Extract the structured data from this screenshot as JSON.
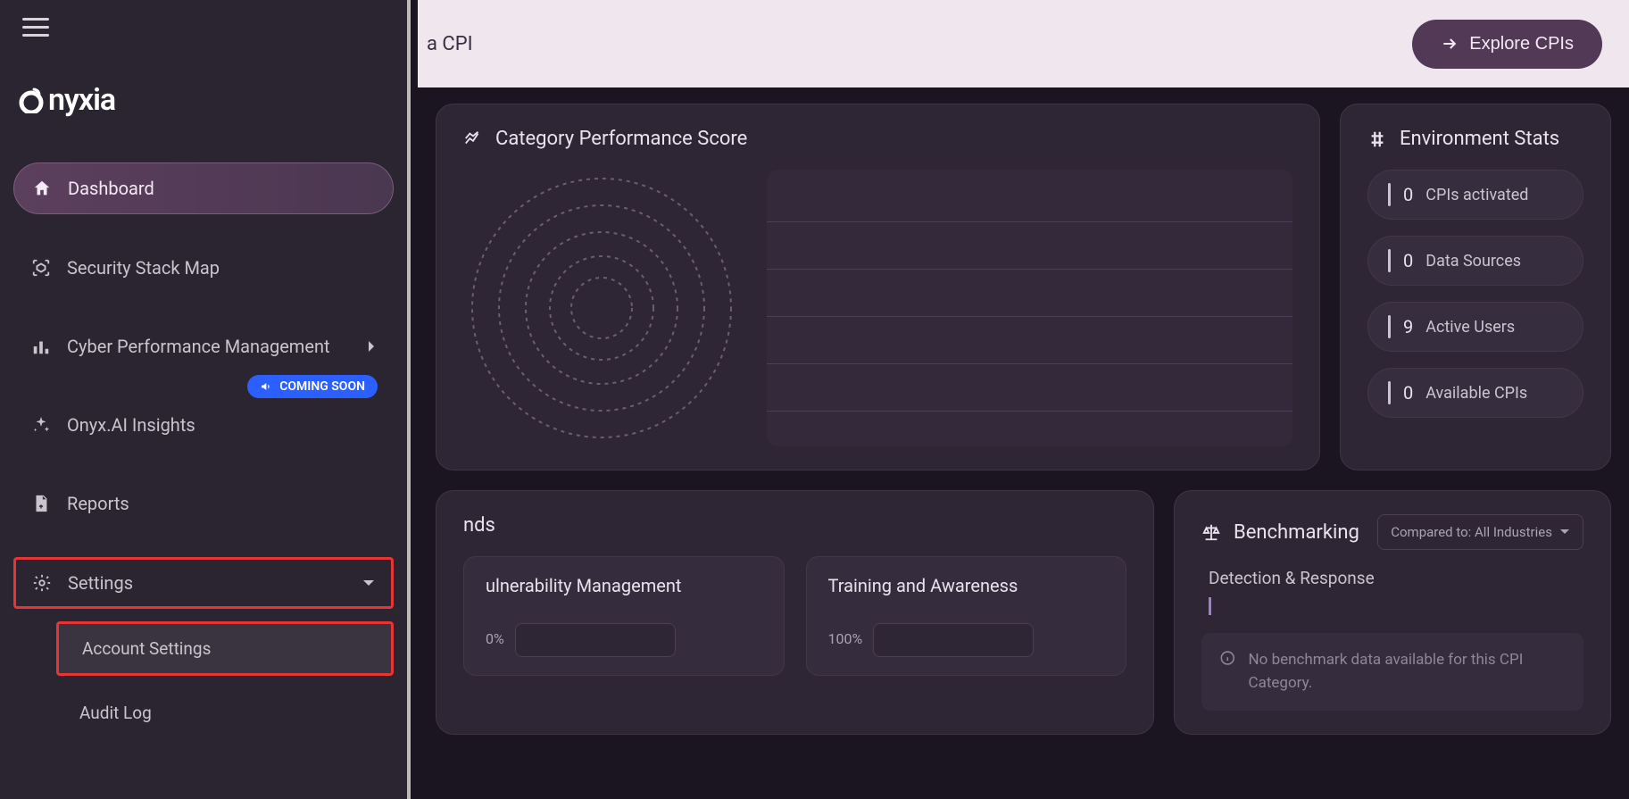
{
  "logo": "nyxia",
  "topbar": {
    "text": "a CPI",
    "explore_label": "Explore CPIs"
  },
  "sidebar": {
    "dashboard": "Dashboard",
    "stack_map": "Security Stack Map",
    "cyber_perf": "Cyber Performance Management",
    "insights": "Onyx.AI Insights",
    "coming_soon": "COMING SOON",
    "reports": "Reports",
    "settings": "Settings",
    "account_settings": "Account Settings",
    "audit_log": "Audit Log"
  },
  "perf": {
    "title": "Category Performance Score"
  },
  "env": {
    "title": "Environment Stats",
    "stats": [
      {
        "num": "0",
        "label": "CPIs activated"
      },
      {
        "num": "0",
        "label": "Data Sources"
      },
      {
        "num": "9",
        "label": "Active Users"
      },
      {
        "num": "0",
        "label": "Available CPIs"
      }
    ]
  },
  "trends": {
    "title": "nds",
    "tiles": [
      {
        "title": "ulnerability Management",
        "pct": "0%"
      },
      {
        "title": "Training and Awareness",
        "pct": "100%"
      }
    ]
  },
  "bench": {
    "title": "Benchmarking",
    "dropdown": "Compared to: All Industries",
    "subtitle": "Detection & Response",
    "empty": "No benchmark data available for this CPI Category."
  }
}
